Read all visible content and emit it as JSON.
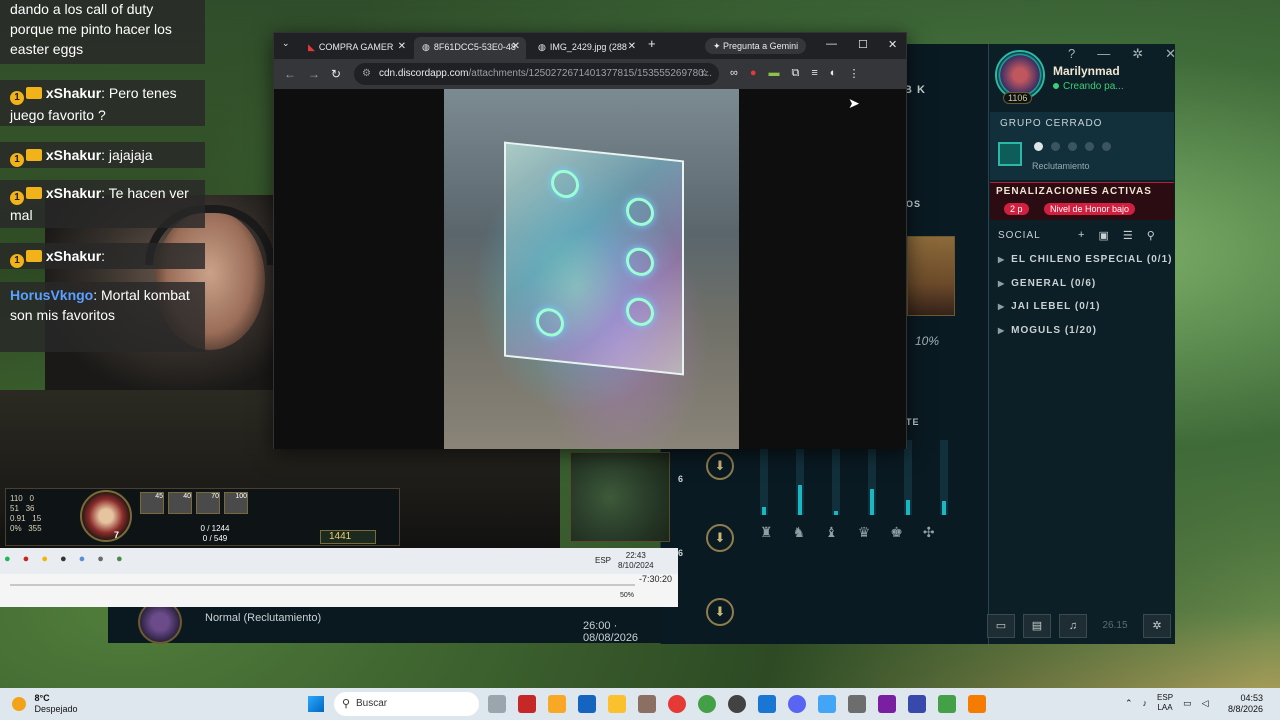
{
  "chrome": {
    "tabs": [
      {
        "label": "COMPRA GAMER"
      },
      {
        "label": "8F61DCC5-53E0-48"
      },
      {
        "label": "IMG_2429.jpg (288"
      }
    ],
    "new_tab_label": "+",
    "gemini_label": "Pregunta a Gemini",
    "url_host": "cdn.discordapp.com",
    "url_path": "/attachments/1250272671401377815/153555269780..."
  },
  "chat": {
    "top_message": "dando a los call of duty porque me pinto hacer los easter eggs",
    "messages": [
      {
        "user": "xShakur",
        "text": ": Pero tenes juego favorito ?",
        "badge": "1"
      },
      {
        "user": "xShakur",
        "text": ": jajajaja",
        "badge": "1"
      },
      {
        "user": "xShakur",
        "text": ": Te hacen ver mal",
        "badge": "1"
      },
      {
        "user": "xShakur",
        "text": ": ",
        "badge": "1"
      },
      {
        "user": "HorusVkngo",
        "text": ": Mortal kombat son mis favoritos"
      }
    ]
  },
  "lol": {
    "profile_name": "Marilynmad",
    "profile_status": "Creando pa...",
    "profile_level": "1106",
    "group_title": "GRUPO CERRADO",
    "group_sub": "Reclutamiento",
    "penalty_title": "PENALIZACIONES ACTIVAS",
    "penalty_chip1": "2 p",
    "penalty_chip2": "Nivel de Honor bajo",
    "social_title": "SOCIAL",
    "social_groups": [
      {
        "label": "EL CHILENO ESPECIAL (0/1)"
      },
      {
        "label": "GENERAL (0/6)"
      },
      {
        "label": "JAI LEBEL (0/1)"
      },
      {
        "label": "MOGULS (1/20)"
      }
    ],
    "champ_pct": "10%",
    "label_k": "B K",
    "label_os": "OS",
    "label_te": "TE",
    "num_6a": "6",
    "num_6b": "6",
    "bottom_num": "26.15",
    "lobby_mode": "Normal (Reclutamiento)",
    "lobby_time": "26:00 · 08/08/2026",
    "bar_fills": [
      0.1,
      0.4,
      0.05,
      0.35,
      0.2,
      0.18
    ]
  },
  "hud": {
    "stats": [
      "110",
      "51",
      "0.91",
      "0%",
      "0",
      "36",
      "15",
      "355"
    ],
    "level": "7",
    "abilities": [
      "45",
      "40",
      "70",
      "100"
    ],
    "hp": "0 / 1244",
    "mana": "0 / 549",
    "gold": "1441"
  },
  "inner_taskbar": {
    "lang": "ESP",
    "time": "22:43",
    "date": "8/10/2024"
  },
  "vlc": {
    "time": "-7:30:20",
    "volume": "50%"
  },
  "taskbar": {
    "temp": "8°C",
    "weather": "Despejado",
    "search_label": "Buscar",
    "lang1": "ESP",
    "lang2": "LAA",
    "time": "04:53",
    "date": "8/8/2026"
  }
}
